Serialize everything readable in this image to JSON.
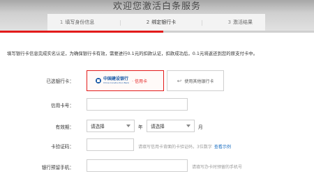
{
  "header": {
    "title": "欢迎您激活白条服务",
    "steps": [
      {
        "num": "1",
        "label": "填写身份信息"
      },
      {
        "num": "2",
        "label": "绑定银行卡"
      },
      {
        "num": "3",
        "label": "激活结果"
      }
    ],
    "active_step": 2,
    "progress": 0.52
  },
  "notice": "填写银行卡信息完成实名认证，为确保银行卡有效，需要进行0.1元的扣款认证，扣款成功后，0.1元将返还到您的原支付卡中。",
  "form": {
    "selected_card_label": "已选银行卡：",
    "bank_name": "中国建设银行",
    "bank_name_en": "China Construction Bank",
    "card_type": "· 信用卡",
    "other_card": "使用其他银行卡",
    "card_number_label": "信用卡号：",
    "validity_label": "有效期：",
    "month_placeholder": "请选择",
    "year_placeholder": "请选择",
    "year_unit": "年",
    "month_unit": "月",
    "cvv_label": "卡验证码：",
    "cvv_hint": "请填写信用卡背面的卡验证码，3位数字",
    "cvv_link": "查看示例",
    "phone_label": "银行预留手机：",
    "phone_hint": "请填写办卡时预留的手机号"
  },
  "colors": {
    "accent": "#e31b1b",
    "bank": "#1a5aa7",
    "link": "#1a6ec2"
  }
}
